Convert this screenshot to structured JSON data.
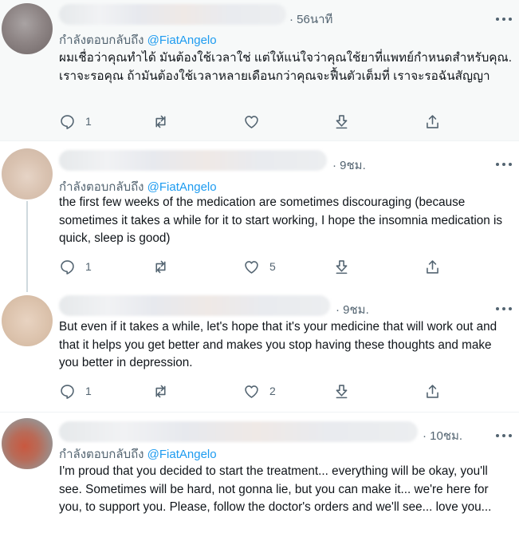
{
  "tweets": [
    {
      "time": "· 56นาที",
      "reply_prefix": "กำลังตอบกลับถึง",
      "reply_handle": "@FiatAngelo",
      "text": "ผมเชื่อว่าคุณทำได้ มันต้องใช้เวลาใช่ แต่ให้แน่ใจว่าคุณใช้ยาที่แพทย์กำหนดสำหรับคุณ. เราจะรอคุณ ถ้ามันต้องใช้เวลาหลายเดือนกว่าคุณจะฟื้นตัวเต็มที่ เราจะรอฉันสัญญา",
      "reply_count": "1",
      "retweet_count": "",
      "like_count": ""
    },
    {
      "time": "· 9ชม.",
      "reply_prefix": "กำลังตอบกลับถึง",
      "reply_handle": "@FiatAngelo",
      "text": "the first few weeks of the medication are sometimes discouraging (because sometimes it takes a while for it to start working, I hope the insomnia medication is quick, sleep is good)",
      "reply_count": "1",
      "retweet_count": "",
      "like_count": "5"
    },
    {
      "time": "· 9ชม.",
      "text": "But even if it takes a while, let's hope that it's your medicine that will work out and that it helps you get better and makes you stop having these thoughts and make you better in depression.",
      "reply_count": "1",
      "retweet_count": "",
      "like_count": "2"
    },
    {
      "time": "· 10ชม.",
      "reply_prefix": "กำลังตอบกลับถึง",
      "reply_handle": "@FiatAngelo",
      "text": "I'm proud that you decided to start the treatment... everything will be okay, you'll see. Sometimes will be hard, not gonna lie, but you can make it... we're here for you, to support you. Please, follow the doctor's orders and we'll see... love you..."
    }
  ],
  "icons": {
    "reply": "speech-bubble-icon",
    "retweet": "retweet-arrows-icon",
    "like": "heart-icon",
    "download": "download-arrow-icon",
    "share": "share-arrow-icon",
    "more": "ellipsis-icon"
  },
  "colors": {
    "accent": "#1d9bf0",
    "muted_text": "#536471",
    "highlight_bg": "#f7f9f9"
  }
}
